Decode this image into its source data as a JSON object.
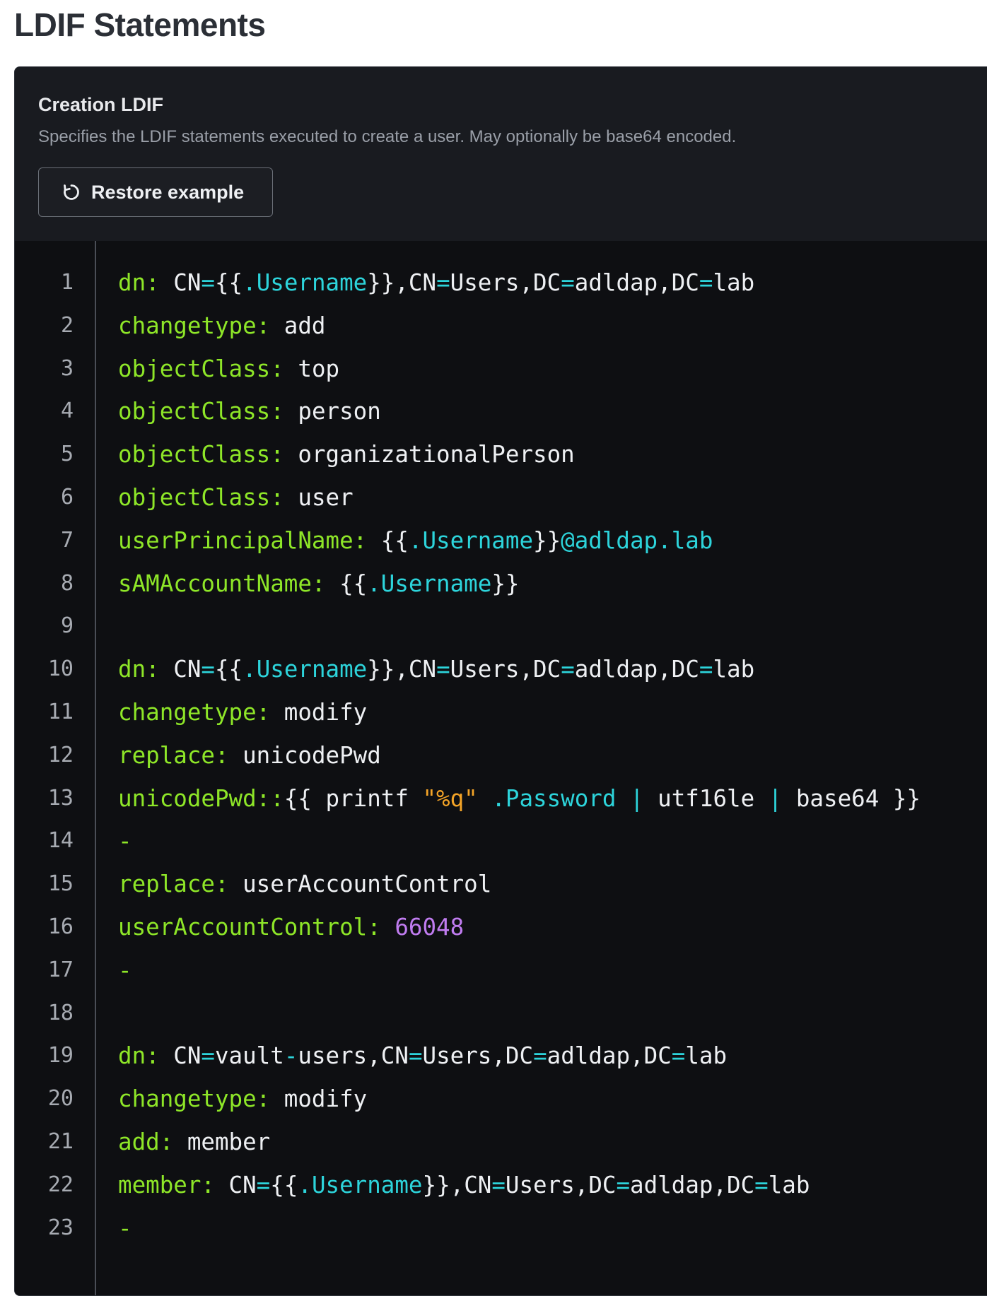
{
  "section": {
    "title": "LDIF Statements"
  },
  "field": {
    "label": "Creation LDIF",
    "help": "Specifies the LDIF statements executed to create a user. May optionally be base64 encoded.",
    "restore_button": {
      "label": "Restore example",
      "icon": "restore-icon"
    }
  },
  "colors": {
    "key": "#8ee628",
    "operator": "#2dd4db",
    "string": "#f4a427",
    "number": "#c07cf0",
    "text": "#eef0f3",
    "editor_background": "#0e0f12"
  },
  "editor": {
    "line_numbers": [
      "1",
      "2",
      "3",
      "4",
      "5",
      "6",
      "7",
      "8",
      "9",
      "10",
      "11",
      "12",
      "13",
      "14",
      "15",
      "16",
      "17",
      "18",
      "19",
      "20",
      "21",
      "22",
      "23"
    ],
    "lines": [
      [
        [
          "key",
          "dn:"
        ],
        [
          "plain",
          " CN"
        ],
        [
          "op",
          "="
        ],
        [
          "plain",
          "{{"
        ],
        [
          "var",
          ".Username"
        ],
        [
          "plain",
          "}},CN"
        ],
        [
          "op",
          "="
        ],
        [
          "plain",
          "Users,DC"
        ],
        [
          "op",
          "="
        ],
        [
          "plain",
          "adldap,DC"
        ],
        [
          "op",
          "="
        ],
        [
          "plain",
          "lab"
        ]
      ],
      [
        [
          "key",
          "changetype:"
        ],
        [
          "plain",
          " add"
        ]
      ],
      [
        [
          "key",
          "objectClass:"
        ],
        [
          "plain",
          " top"
        ]
      ],
      [
        [
          "key",
          "objectClass:"
        ],
        [
          "plain",
          " person"
        ]
      ],
      [
        [
          "key",
          "objectClass:"
        ],
        [
          "plain",
          " organizationalPerson"
        ]
      ],
      [
        [
          "key",
          "objectClass:"
        ],
        [
          "plain",
          " user"
        ]
      ],
      [
        [
          "key",
          "userPrincipalName:"
        ],
        [
          "plain",
          " {{"
        ],
        [
          "var",
          ".Username"
        ],
        [
          "plain",
          "}}"
        ],
        [
          "var",
          "@adldap.lab"
        ]
      ],
      [
        [
          "key",
          "sAMAccountName:"
        ],
        [
          "plain",
          " {{"
        ],
        [
          "var",
          ".Username"
        ],
        [
          "plain",
          "}}"
        ]
      ],
      [],
      [
        [
          "key",
          "dn:"
        ],
        [
          "plain",
          " CN"
        ],
        [
          "op",
          "="
        ],
        [
          "plain",
          "{{"
        ],
        [
          "var",
          ".Username"
        ],
        [
          "plain",
          "}},CN"
        ],
        [
          "op",
          "="
        ],
        [
          "plain",
          "Users,DC"
        ],
        [
          "op",
          "="
        ],
        [
          "plain",
          "adldap,DC"
        ],
        [
          "op",
          "="
        ],
        [
          "plain",
          "lab"
        ]
      ],
      [
        [
          "key",
          "changetype:"
        ],
        [
          "plain",
          " modify"
        ]
      ],
      [
        [
          "key",
          "replace:"
        ],
        [
          "plain",
          " unicodePwd"
        ]
      ],
      [
        [
          "key",
          "unicodePwd::"
        ],
        [
          "plain",
          "{{ printf "
        ],
        [
          "str",
          "\"%q\""
        ],
        [
          "plain",
          " "
        ],
        [
          "var",
          ".Password"
        ],
        [
          "plain",
          " "
        ],
        [
          "op",
          "|"
        ],
        [
          "plain",
          " utf16le "
        ],
        [
          "op",
          "|"
        ],
        [
          "plain",
          " base64 }}"
        ]
      ],
      [
        [
          "key",
          "-"
        ]
      ],
      [
        [
          "key",
          "replace:"
        ],
        [
          "plain",
          " userAccountControl"
        ]
      ],
      [
        [
          "key",
          "userAccountControl:"
        ],
        [
          "plain",
          " "
        ],
        [
          "num",
          "66048"
        ]
      ],
      [
        [
          "key",
          "-"
        ]
      ],
      [],
      [
        [
          "key",
          "dn:"
        ],
        [
          "plain",
          " CN"
        ],
        [
          "op",
          "="
        ],
        [
          "plain",
          "vault"
        ],
        [
          "op",
          "-"
        ],
        [
          "plain",
          "users,CN"
        ],
        [
          "op",
          "="
        ],
        [
          "plain",
          "Users,DC"
        ],
        [
          "op",
          "="
        ],
        [
          "plain",
          "adldap,DC"
        ],
        [
          "op",
          "="
        ],
        [
          "plain",
          "lab"
        ]
      ],
      [
        [
          "key",
          "changetype:"
        ],
        [
          "plain",
          " modify"
        ]
      ],
      [
        [
          "key",
          "add:"
        ],
        [
          "plain",
          " member"
        ]
      ],
      [
        [
          "key",
          "member:"
        ],
        [
          "plain",
          " CN"
        ],
        [
          "op",
          "="
        ],
        [
          "plain",
          "{{"
        ],
        [
          "var",
          ".Username"
        ],
        [
          "plain",
          "}},CN"
        ],
        [
          "op",
          "="
        ],
        [
          "plain",
          "Users,DC"
        ],
        [
          "op",
          "="
        ],
        [
          "plain",
          "adldap,DC"
        ],
        [
          "op",
          "="
        ],
        [
          "plain",
          "lab"
        ]
      ],
      [
        [
          "key",
          "-"
        ]
      ]
    ]
  }
}
